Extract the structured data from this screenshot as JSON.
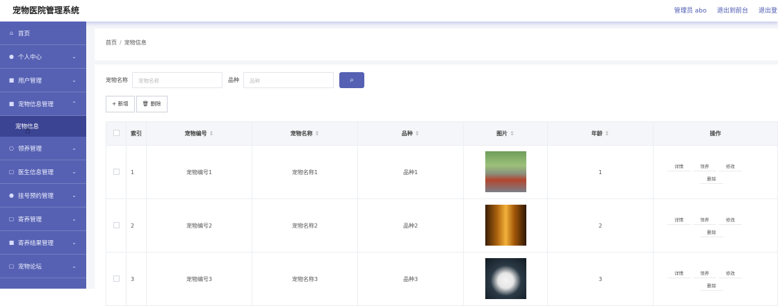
{
  "header": {
    "title": "宠物医院管理系统",
    "admin_label": "管理员 abo",
    "back_link": "退出到前台",
    "logout_link": "退出登录"
  },
  "sidebar": {
    "items": [
      {
        "label": "首页",
        "icon": "home-icon",
        "has_chevron": false
      },
      {
        "label": "个人中心",
        "icon": "user-icon",
        "has_chevron": true
      },
      {
        "label": "用户管理",
        "icon": "users-icon",
        "has_chevron": true
      },
      {
        "label": "宠物信息管理",
        "icon": "pet-icon",
        "has_chevron": true,
        "expanded": true
      },
      {
        "label": "领养管理",
        "icon": "adopt-icon",
        "has_chevron": true
      },
      {
        "label": "医生信息管理",
        "icon": "doctor-icon",
        "has_chevron": true
      },
      {
        "label": "挂号预约管理",
        "icon": "register-icon",
        "has_chevron": true
      },
      {
        "label": "寄养管理",
        "icon": "foster-icon",
        "has_chevron": true
      },
      {
        "label": "寄养结果管理",
        "icon": "result-icon",
        "has_chevron": true
      },
      {
        "label": "宠物论坛",
        "icon": "forum-icon",
        "has_chevron": true
      }
    ],
    "active_sub": "宠物信息"
  },
  "breadcrumb": {
    "home": "首页",
    "separator": "/",
    "current": "宠物信息"
  },
  "search": {
    "name_label": "宠物名称",
    "name_placeholder": "宠物名称",
    "breed_label": "品种",
    "breed_placeholder": "品种"
  },
  "actions": {
    "add": "+ 新增",
    "delete": "删除"
  },
  "table": {
    "columns": [
      "索引",
      "宠物编号",
      "宠物名称",
      "品种",
      "图片",
      "年龄",
      "操作"
    ],
    "rows": [
      {
        "index": "1",
        "code": "宠物编号1",
        "name": "宠物名称1",
        "breed": "品种1",
        "age": "1"
      },
      {
        "index": "2",
        "code": "宠物编号2",
        "name": "宠物名称2",
        "breed": "品种2",
        "age": "2"
      },
      {
        "index": "3",
        "code": "宠物编号3",
        "name": "宠物名称3",
        "breed": "品种3",
        "age": "3"
      }
    ],
    "ops": {
      "detail": "详情",
      "adopt": "领养",
      "edit": "修改",
      "delete": "删除"
    }
  },
  "colors": {
    "accent": "#5661b3",
    "accent_dark": "#3b4393"
  }
}
